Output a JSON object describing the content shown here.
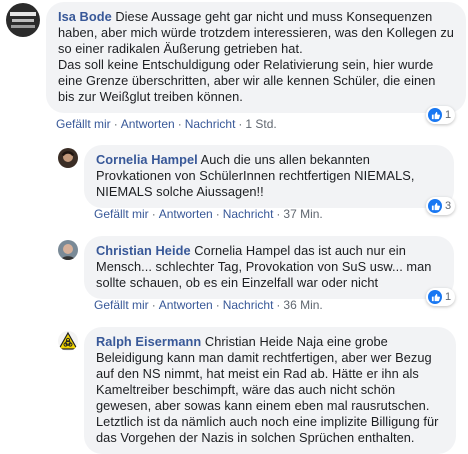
{
  "comments": [
    {
      "author": "Isa Bode",
      "text": "Diese Aussage geht gar nicht und muss Konsequenzen haben, aber mich würde trotzdem interessieren, was den Kollegen zu so einer radikalen Äußerung getrieben hat.",
      "text2": "Das soll keine Entschuldigung oder Relativierung sein, hier wurde eine Grenze überschritten, aber wir alle kennen Schüler, die einen bis zur Weißglut treiben können.",
      "like": "Gefällt mir",
      "reply": "Antworten",
      "message": "Nachricht",
      "time": "1 Std.",
      "reactions": "1"
    },
    {
      "author": "Cornelia Hampel",
      "text": "Auch die uns allen bekannten Provkationen von SchülerInnen rechtfertigen NIEMALS, NIEMALS solche Aiussagen!!",
      "like": "Gefällt mir",
      "reply": "Antworten",
      "message": "Nachricht",
      "time": "37 Min.",
      "reactions": "3"
    },
    {
      "author": "Christian Heide",
      "text": "Cornelia Hampel das ist auch nur ein Mensch... schlechter Tag, Provokation von SuS usw... man sollte schauen, ob es ein Einzelfall war oder nicht",
      "like": "Gefällt mir",
      "reply": "Antworten",
      "message": "Nachricht",
      "time": "36 Min.",
      "reactions": "1"
    },
    {
      "author": "Ralph Eisermann",
      "text": "Christian Heide Naja eine grobe Beleidigung kann man damit rechtfertigen, aber wer Bezug auf den NS nimmt, hat meist ein Rad ab. Hätte er ihn als Kameltreiber beschimpft, wäre das auch nicht schön gewesen, aber sowas kann einem eben mal rausrutschen. Letztlich ist da nämlich auch noch eine implizite Billigung für das Vorgehen der Nazis in solchen Sprüchen enthalten."
    }
  ],
  "colors": {
    "link": "#385898",
    "bubble": "#f2f3f5",
    "like_blue": "#1877f2"
  }
}
